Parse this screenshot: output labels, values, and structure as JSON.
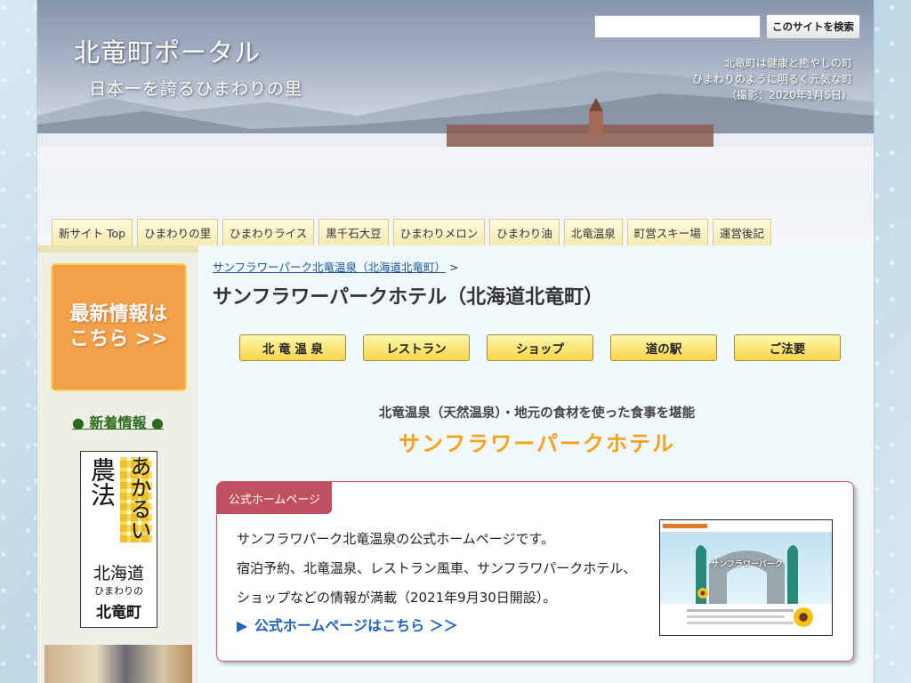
{
  "header": {
    "site_title": "北竜町ポータル",
    "site_subtitle": "日本一を誇るひまわりの里",
    "search_button_label": "このサイトを検索",
    "tagline": [
      "北竜町は健康と癒やしの町",
      "ひまわりのように明るく元気な町",
      "（撮影：2020年1月5日）"
    ]
  },
  "nav": {
    "items": [
      "新サイト Top",
      "ひまわりの里",
      "ひまわりライス",
      "黒千石大豆",
      "ひまわりメロン",
      "ひまわり油",
      "北竜温泉",
      "町営スキー場",
      "運営後記"
    ]
  },
  "sidebar": {
    "latest_banner_line1": "最新情報は",
    "latest_banner_line2": "こちら >>",
    "news_heading": "● 新着情報 ●",
    "farm_law_top": "あかるい",
    "farm_law_left": "農法",
    "farm_law_region": "北海道",
    "farm_law_sub": "ひまわりの",
    "farm_law_town": "北竜町"
  },
  "main": {
    "breadcrumb_link": "サンフラワーパーク北竜温泉（北海道北竜町）",
    "breadcrumb_sep": ">",
    "page_title": "サンフラワーパークホテル（北海道北竜町）",
    "subnav": [
      "北 竜 温 泉",
      "レストラン",
      "ショップ",
      "道の駅",
      "ご法要"
    ],
    "hotel_tagline": "北竜温泉（天然温泉）・地元の食材を使った食事を堪能",
    "hotel_name": "サンフラワーパークホテル",
    "card": {
      "tab_label": "公式ホームページ",
      "text_line1": "サンフラワパーク北竜温泉の公式ホームページです。",
      "text_line2": "宿泊予約、北竜温泉、レストラン風車、サンフラワパークホテル、ショップなどの情報が満載（2021年9月30日開設）。",
      "link_label": "公式ホームページはこちら ＞＞",
      "thumb_caption": "サンフラワーパーク"
    }
  },
  "colors": {
    "accent_orange": "#f5a01e",
    "card_red": "#c0505f",
    "link_blue": "#1e63b8",
    "news_green": "#2a6a1a"
  }
}
